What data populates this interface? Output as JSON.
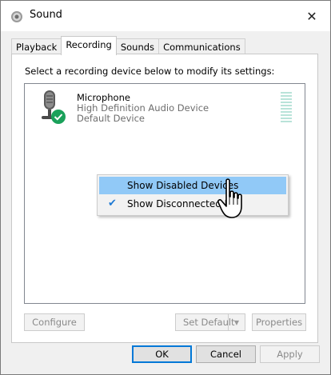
{
  "window": {
    "title": "Sound",
    "close_glyph": "✕"
  },
  "tabs": [
    {
      "label": "Playback"
    },
    {
      "label": "Recording"
    },
    {
      "label": "Sounds"
    },
    {
      "label": "Communications"
    }
  ],
  "active_tab": "Recording",
  "panel": {
    "instructions": "Select a recording device below to modify its settings:"
  },
  "devices": [
    {
      "name": "Microphone",
      "description": "High Definition Audio Device",
      "status": "Default Device",
      "icon": "microphone-icon",
      "badge": "default-check-icon"
    }
  ],
  "context_menu": {
    "items": [
      {
        "label": "Show Disabled Devices",
        "checked": false,
        "highlighted": true
      },
      {
        "label": "Show Disconnected D",
        "checked": true,
        "highlighted": false
      }
    ]
  },
  "device_buttons": {
    "configure": "Configure",
    "set_default": "Set Default",
    "properties": "Properties"
  },
  "dialog_buttons": {
    "ok": "OK",
    "cancel": "Cancel",
    "apply": "Apply"
  },
  "colors": {
    "menu_highlight": "#91c9f7",
    "check": "#1f7ad4",
    "level_meter": "#b9e3d9",
    "default_badge": "#1aa15a"
  }
}
